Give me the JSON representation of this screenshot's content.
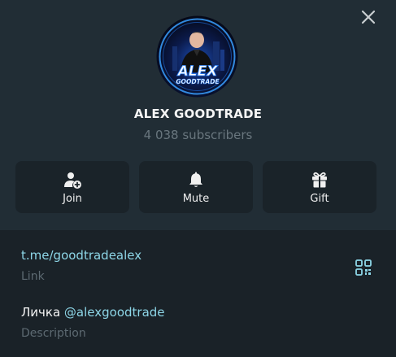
{
  "profile": {
    "name": "ALEX GOODTRADE",
    "subscribers": "4 038 subscribers",
    "avatar_text_top": "ALEX",
    "avatar_text_bottom": "GOODTRADE"
  },
  "actions": [
    {
      "label": "Join",
      "icon": "add-user-icon"
    },
    {
      "label": "Mute",
      "icon": "bell-icon"
    },
    {
      "label": "Gift",
      "icon": "gift-icon"
    }
  ],
  "info": {
    "link": "t.me/goodtradealex",
    "link_label": "Link",
    "description_prefix": "Личка ",
    "description_mention": "@alexgoodtrade",
    "description_label": "Description"
  },
  "colors": {
    "background": "#212d35",
    "info_background": "#1a2228",
    "button_background": "#1a2329",
    "accent": "#8dd6e7",
    "muted": "#69767e"
  },
  "icons": {
    "close": "close-icon",
    "qr": "qr-code-icon"
  }
}
